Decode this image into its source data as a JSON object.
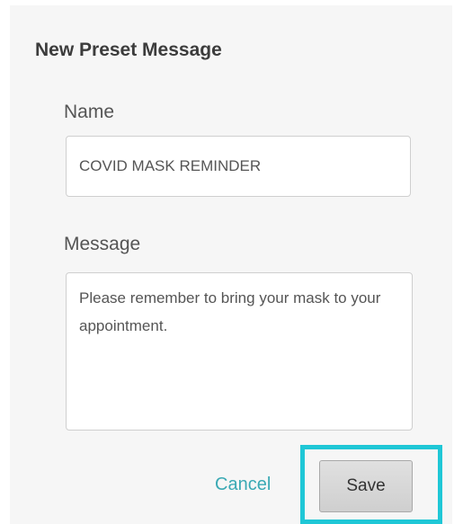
{
  "dialog": {
    "title": "New Preset Message"
  },
  "form": {
    "name_label": "Name",
    "name_value": "COVID MASK REMINDER",
    "message_label": "Message",
    "message_value": "Please remember to bring your mask to your appointment."
  },
  "actions": {
    "cancel_label": "Cancel",
    "save_label": "Save"
  },
  "colors": {
    "accent": "#3aa9b4",
    "highlight": "#1fc7d6",
    "panel_background": "#f6f6f6"
  }
}
